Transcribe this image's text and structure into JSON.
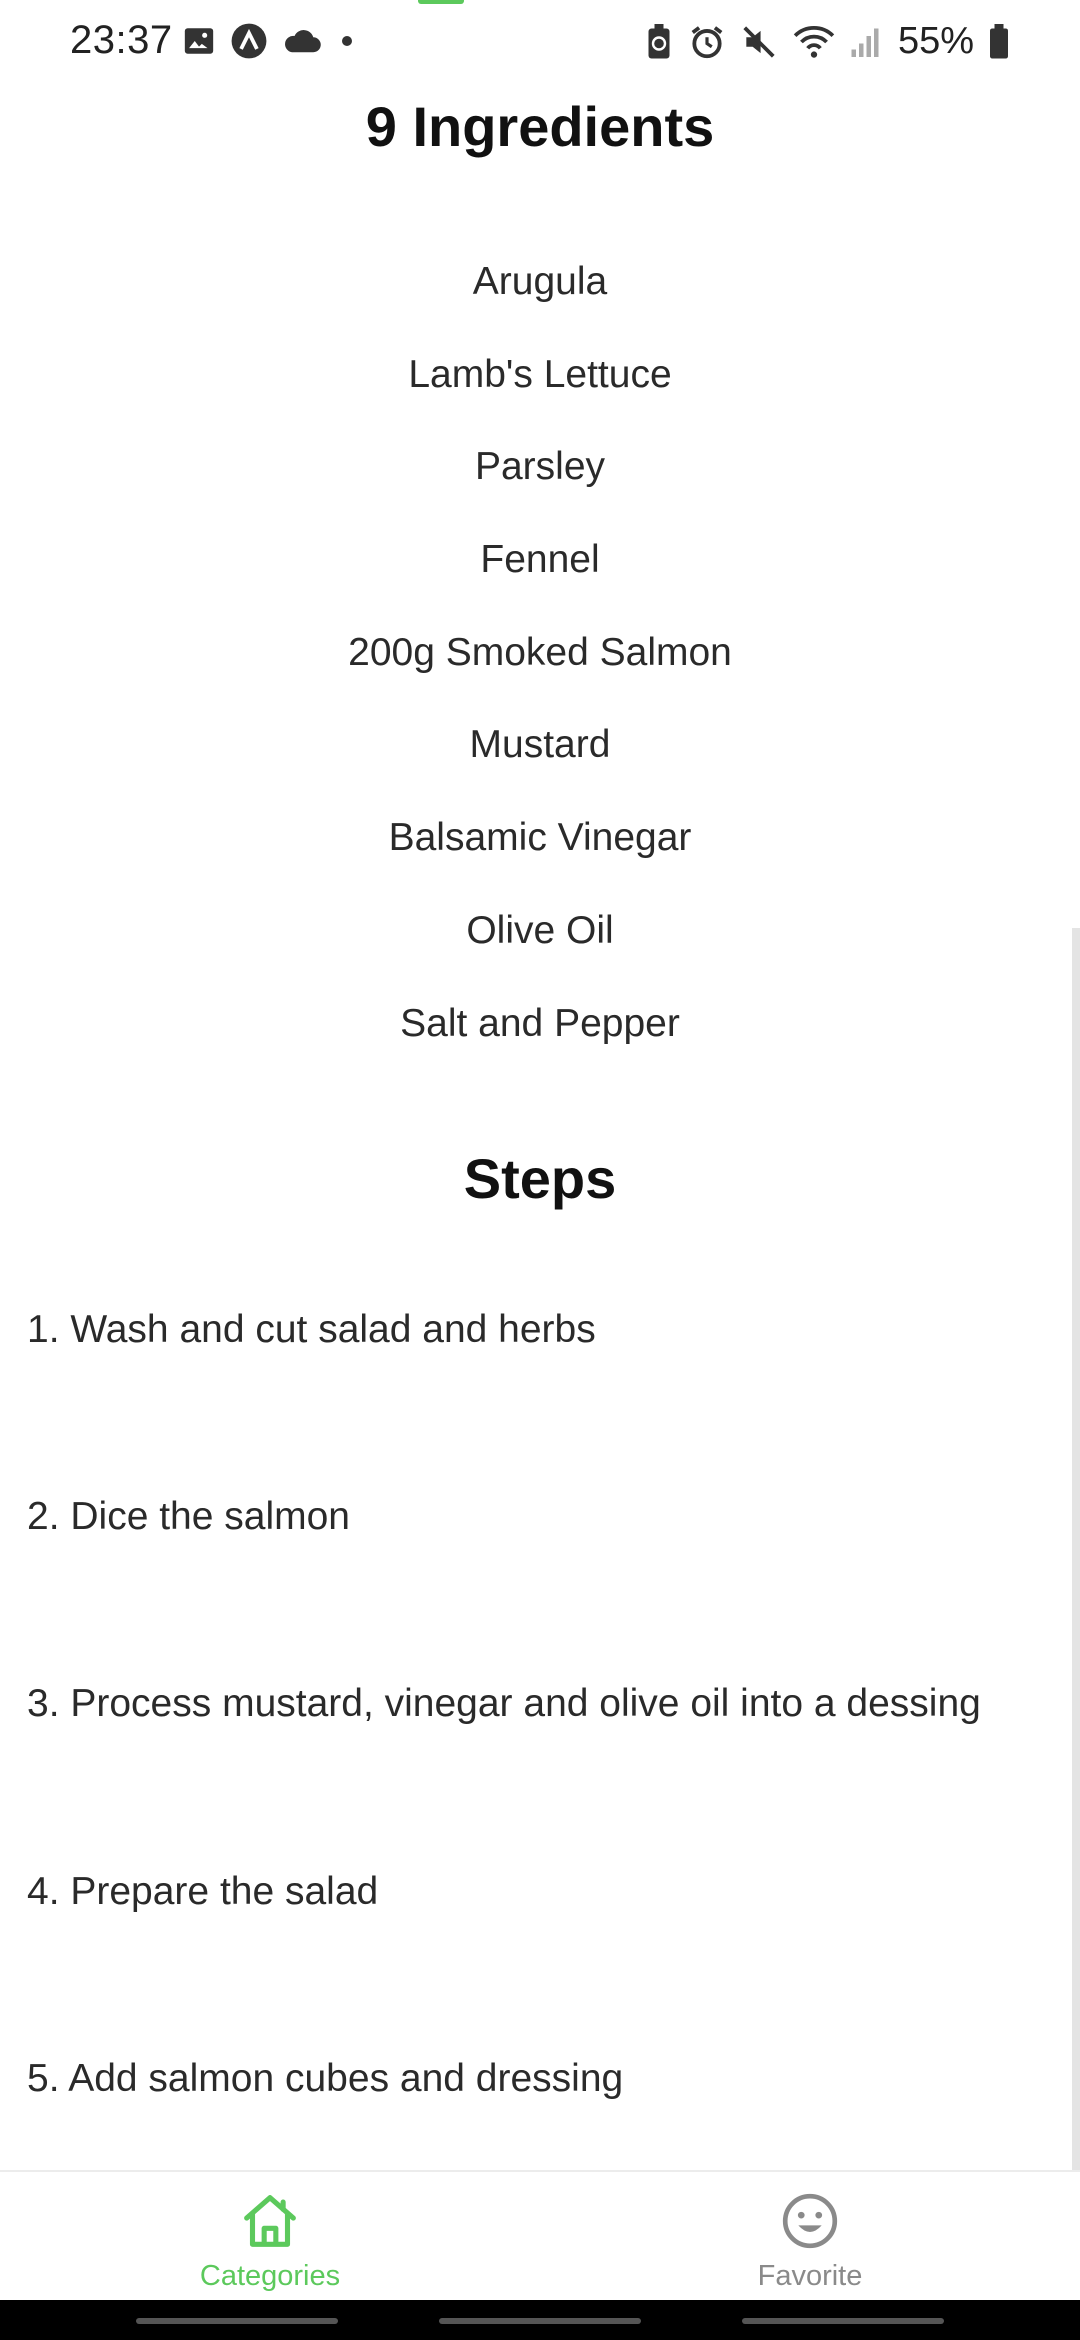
{
  "status_bar": {
    "time": "23:37",
    "battery_percent": "55%",
    "left_icons": [
      "gallery-icon",
      "app-a-icon",
      "cloud-icon",
      "dot-icon"
    ],
    "right_icons": [
      "battery-saver-icon",
      "alarm-icon",
      "mute-icon",
      "wifi-icon",
      "signal-icon",
      "battery-icon"
    ]
  },
  "ingredients": {
    "title": "9 Ingredients",
    "items": [
      "Arugula",
      "Lamb's Lettuce",
      "Parsley",
      "Fennel",
      "200g Smoked Salmon",
      "Mustard",
      "Balsamic Vinegar",
      "Olive Oil",
      "Salt and Pepper"
    ]
  },
  "steps": {
    "title": "Steps",
    "items": [
      "1. Wash and cut salad and herbs",
      "2. Dice the salmon",
      "3. Process mustard, vinegar and olive oil into a dessing",
      "4. Prepare the salad",
      "5. Add salmon cubes and dressing"
    ]
  },
  "bottom_nav": {
    "items": [
      {
        "label": "Categories",
        "icon": "home-icon",
        "active": true
      },
      {
        "label": "Favorite",
        "icon": "smiley-icon",
        "active": false
      }
    ]
  },
  "colors": {
    "accent": "#5cc95c",
    "inactive": "#8a8a8a",
    "text": "#2a2a2a",
    "heading": "#111111"
  }
}
